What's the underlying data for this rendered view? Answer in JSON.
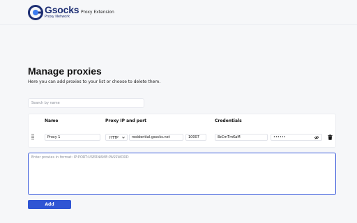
{
  "header": {
    "brand_name": "Gsocks",
    "brand_sub": "Proxy Network",
    "extension_label": "Proxy Extension"
  },
  "main": {
    "title": "Manage proxies",
    "description": "Here you can add proxies to your list or choose to delete them.",
    "search_placeholder": "Search by name"
  },
  "table": {
    "columns": [
      "Name",
      "Proxy IP and port",
      "Credentials"
    ],
    "rows": [
      {
        "name": "Proxy 1",
        "protocol": "HTTP",
        "host": "residential.gsocks.net",
        "port": "10007",
        "username": "8zCmTmKaM",
        "password": "••••••"
      }
    ]
  },
  "bulk_input": {
    "placeholder": "Enter proxies in format: IP:PORT:USERNAME:PASSWORD"
  },
  "add_button": "Add",
  "colors": {
    "accent": "#2f55d4",
    "brand": "#1d2e73"
  },
  "icons": [
    "gsocks-logo-icon",
    "drag-handle-icon",
    "chevron-down-icon",
    "eye-off-icon",
    "trash-icon"
  ]
}
